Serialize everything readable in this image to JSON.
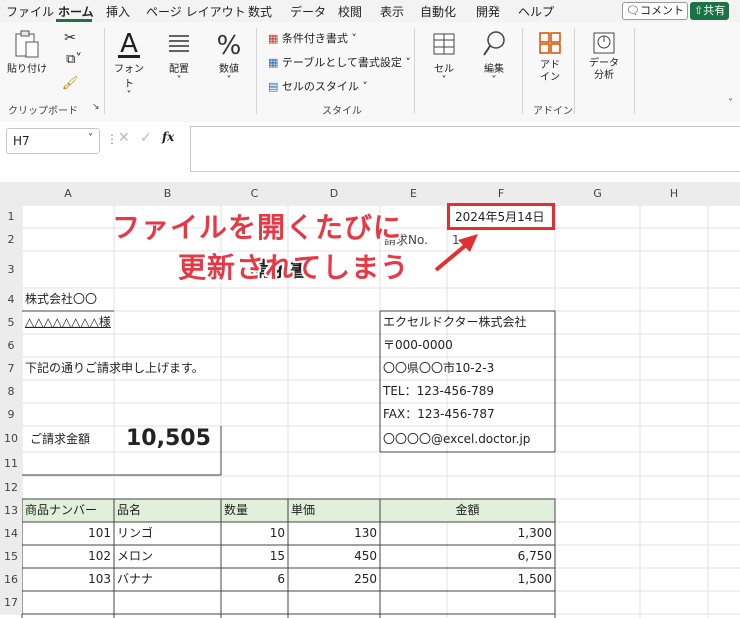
{
  "menu": [
    "ファイル",
    "ホーム",
    "挿入",
    "ページ レイアウト",
    "数式",
    "データ",
    "校閲",
    "表示",
    "自動化",
    "開発",
    "ヘルプ"
  ],
  "top_buttons": {
    "comment": "コメント",
    "share": "共有"
  },
  "ribbon": {
    "paste": "貼り付け",
    "clipboard_group": "クリップボード",
    "font": "フォント",
    "align": "配置",
    "number": "数値",
    "style_items": [
      "条件付き書式 ˅",
      "テーブルとして書式設定 ˅",
      "セルのスタイル ˅"
    ],
    "style_group": "スタイル",
    "cell": "セル",
    "edit": "編集",
    "addin": "アド\nイン",
    "addin_group": "アドイン",
    "analyze": "データ\n分析"
  },
  "formula_bar": {
    "name_box": "H7",
    "fx": "fx",
    "value": ""
  },
  "columns": [
    "A",
    "B",
    "C",
    "D",
    "E",
    "F",
    "G",
    "H"
  ],
  "rows": [
    "1",
    "2",
    "3",
    "4",
    "5",
    "6",
    "7",
    "8",
    "9",
    "10",
    "11",
    "12",
    "13",
    "14",
    "15",
    "16",
    "17"
  ],
  "sheet": {
    "date": "2024年5月14日",
    "invoice_no_label": "請求No.",
    "invoice_no_value": "1",
    "title": "請求書",
    "client": "株式会社〇〇",
    "client_name": "△△△△△△△△様",
    "company": "エクセルドクター株式会社",
    "postal": "〒000-0000",
    "address": "〇〇県〇〇市10-2-3",
    "tel": "TEL：123-456-789",
    "fax": "FAX：123-456-787",
    "email": "〇〇〇〇@excel.doctor.jp",
    "message": "下記の通りご請求申し上げます。",
    "amount_label": "ご請求金額",
    "amount": "10,505",
    "table_headers": [
      "商品ナンバー",
      "品名",
      "数量",
      "単価",
      "金額"
    ],
    "items": [
      {
        "no": "101",
        "name": "リンゴ",
        "qty": "10",
        "price": "130",
        "amount": "1,300"
      },
      {
        "no": "102",
        "name": "メロン",
        "qty": "15",
        "price": "450",
        "amount": "6,750"
      },
      {
        "no": "103",
        "name": "バナナ",
        "qty": "6",
        "price": "250",
        "amount": "1,500"
      }
    ]
  },
  "annotation": {
    "line1": "ファイルを開くたびに",
    "line2": "更新されてしまう",
    "color": "#e63946"
  }
}
